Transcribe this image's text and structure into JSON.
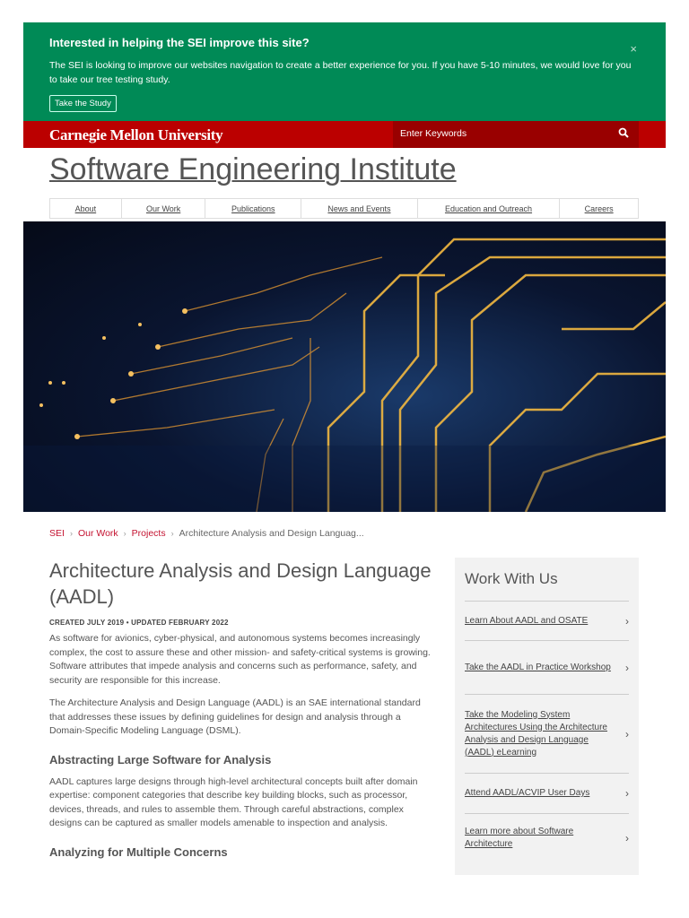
{
  "banner": {
    "title": "Interested in helping the SEI improve this site?",
    "text": "The SEI is looking to improve our websites navigation to create a better experience for you. If you have 5-10 minutes, we would love for you to take our tree testing study.",
    "button": "Take the Study",
    "close": "×"
  },
  "header": {
    "logo": "Carnegie Mellon University",
    "search_placeholder": "Enter Keywords",
    "site_title": "Software Engineering Institute"
  },
  "nav": [
    "About",
    "Our Work",
    "Publications",
    "News and Events",
    "Education and Outreach",
    "Careers"
  ],
  "breadcrumb": {
    "items": [
      "SEI",
      "Our Work",
      "Projects"
    ],
    "current": "Architecture Analysis and Design Languag...",
    "sep": "›"
  },
  "article": {
    "title": "Architecture Analysis and Design Language (AADL)",
    "meta": "CREATED JULY 2019 • UPDATED FEBRUARY 2022",
    "p1": "As software for avionics, cyber-physical, and autonomous systems becomes increasingly complex, the cost to assure these and other mission- and safety-critical systems is growing. Software attributes that impede analysis and concerns such as performance, safety, and security are responsible for this increase.",
    "p2": "The Architecture Analysis and Design Language (AADL) is an SAE international standard that addresses these issues by defining guidelines for design and analysis through a Domain-Specific Modeling Language (DSML).",
    "h2": "Abstracting Large Software for Analysis",
    "p3": "AADL captures large designs through high-level architectural concepts built after domain expertise: component categories that describe key building blocks, such as processor, devices, threads, and rules to assemble them. Through careful abstractions, complex designs can be captured as smaller models amenable to inspection and analysis.",
    "h3": "Analyzing for Multiple Concerns"
  },
  "sidebar": {
    "title": "Work With Us",
    "chevron": "›",
    "items": [
      "Learn About AADL and OSATE",
      "Take the AADL in Practice Workshop",
      "Take the Modeling System Architectures Using the Architecture Analysis and Design Language (AADL) eLearning",
      "Attend AADL/ACVIP User Days",
      "Learn more about Software Architecture"
    ]
  }
}
